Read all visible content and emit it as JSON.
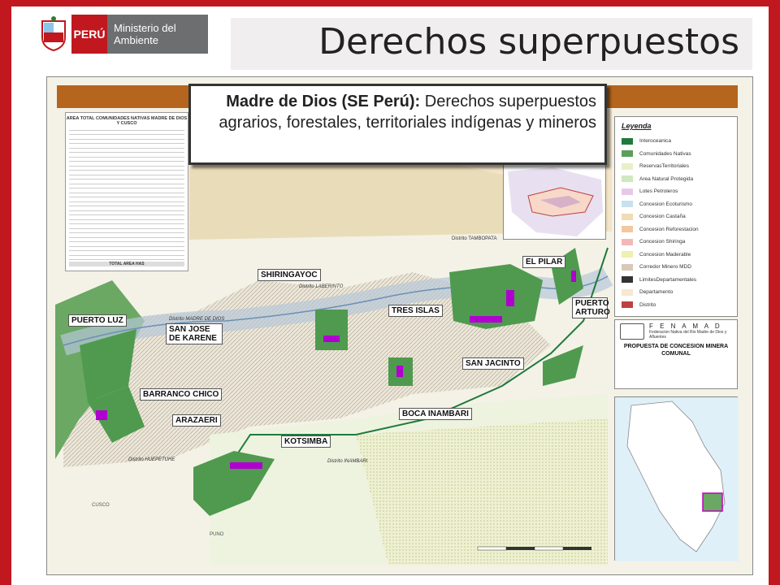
{
  "header": {
    "logo_country": "PERÚ",
    "logo_ministry": "Ministerio del Ambiente",
    "title": "Derechos superpuestos"
  },
  "callout": {
    "bold": "Madre de Dios (SE Perú):",
    "text": "Derechos superpuestos agrarios, forestales, territoriales indígenas y mineros"
  },
  "communities": [
    {
      "name": "SHIRINGAYOC"
    },
    {
      "name": "EL PILAR"
    },
    {
      "name": "TRES ISLAS"
    },
    {
      "name": "PUERTO ARTURO"
    },
    {
      "name": "PUERTO LUZ"
    },
    {
      "name": "SAN JOSE DE KARENE"
    },
    {
      "name": "SAN JACINTO"
    },
    {
      "name": "BARRANCO CHICO"
    },
    {
      "name": "BOCA INAMBARI"
    },
    {
      "name": "ARAZAERI"
    },
    {
      "name": "KOTSIMBA"
    }
  ],
  "table": {
    "title": "AREA TOTAL COMUNIDADES NATIVAS MADRE DE DIOS Y CUSCO",
    "total_label": "TOTAL AREA HAS"
  },
  "legend": {
    "title": "Leyenda",
    "items": [
      {
        "label": "Interoceanica",
        "color": "#1e7a3c"
      },
      {
        "label": "Comunidades Nativas",
        "color": "#5aa05a"
      },
      {
        "label": "ReservasTerritoriales",
        "color": "#e8f0c8"
      },
      {
        "label": "Area Natural Protegida",
        "color": "#cfe8c0"
      },
      {
        "label": "Lotes Petroleros",
        "color": "#e8c8e8"
      },
      {
        "label": "Concesion Ecoturismo",
        "color": "#c8e0f0"
      },
      {
        "label": "Concesion Castaña",
        "color": "#f0dcb4"
      },
      {
        "label": "Concesion Reforestacion",
        "color": "#f4c89c"
      },
      {
        "label": "Concesion Shiringa",
        "color": "#f4b8b8"
      },
      {
        "label": "Concesion Maderable",
        "color": "#f0f0b0"
      },
      {
        "label": "Corredor Minero MDD",
        "color": "#d8c8b8"
      },
      {
        "label": "LimitesDepartamentales",
        "color": "#333333"
      },
      {
        "label": "Departamento",
        "color": "#f8e8d0"
      },
      {
        "label": "Distrito",
        "color": "#c04040"
      }
    ]
  },
  "fenamad": {
    "name": "F E N A M A D",
    "subtitle": "Federacion Nativa del Rio Madre de Dios y Afluentes",
    "title": "PROPUESTA DE CONCESION MINERA COMUNAL"
  },
  "map_places": {
    "tambopata": "Distrito TAMBOPATA",
    "laberinto": "Distrito LABERINTO",
    "madre_de_dios": "Distrito MADRE DE DIOS",
    "inambari": "Distrito INAMBARI",
    "huepetuhe": "Distrito HUEPETUHE",
    "cusco": "CUSCO",
    "puno": "PUNO"
  },
  "colors": {
    "brand_red": "#c1171f",
    "community_green": "#5aa05a",
    "mining_purple": "#b000d0",
    "header_bar": "#b5651d"
  }
}
